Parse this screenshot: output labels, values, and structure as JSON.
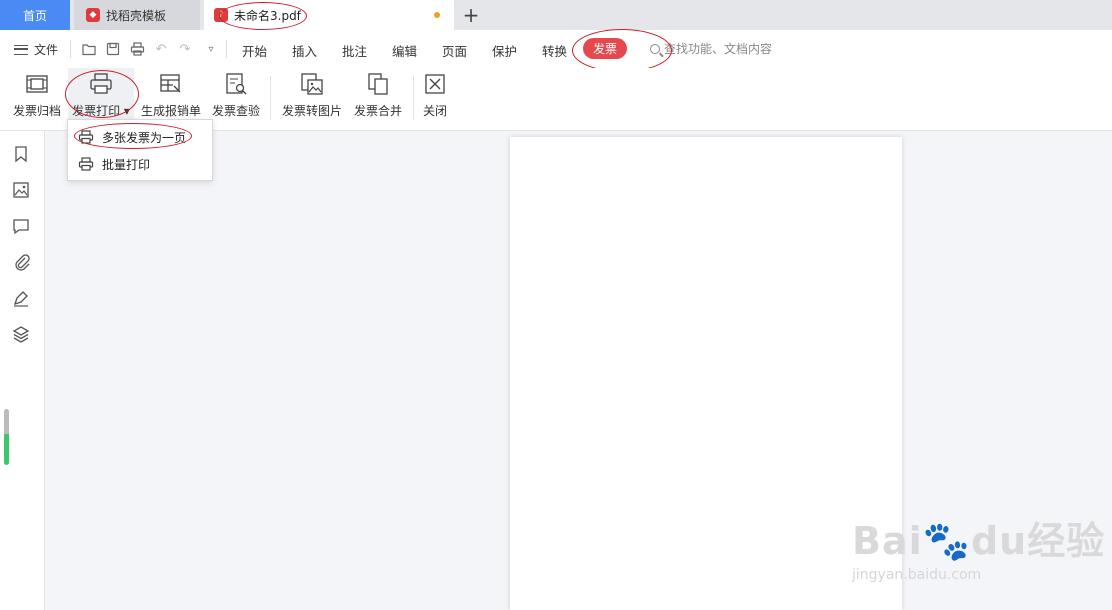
{
  "tabs": {
    "home": "首页",
    "templates": "找稻壳模板",
    "document": "未命名3.pdf",
    "add": "+"
  },
  "menu": {
    "file": "文件",
    "items": [
      "开始",
      "插入",
      "批注",
      "编辑",
      "页面",
      "保护",
      "转换"
    ],
    "active": "发票",
    "search_placeholder": "查找功能、文档内容"
  },
  "ribbon": {
    "buttons": [
      "发票归档",
      "发票打印",
      "生成报销单",
      "发票查验",
      "发票转图片",
      "发票合并",
      "关闭"
    ]
  },
  "dropdown": {
    "items": [
      "多张发票为一页",
      "批量打印"
    ]
  },
  "watermark": {
    "brand": "Bai",
    "brand_tail": "du",
    "brand_cn": "经验",
    "url": "jingyan.baidu.com"
  },
  "colors": {
    "accent_blue": "#4a8af4",
    "active_red": "#e5484d",
    "annotation_red": "#c8202a"
  },
  "icons": [
    "bookmark-icon",
    "image-icon",
    "comment-icon",
    "paperclip-icon",
    "signature-pen-icon",
    "layers-icon"
  ]
}
